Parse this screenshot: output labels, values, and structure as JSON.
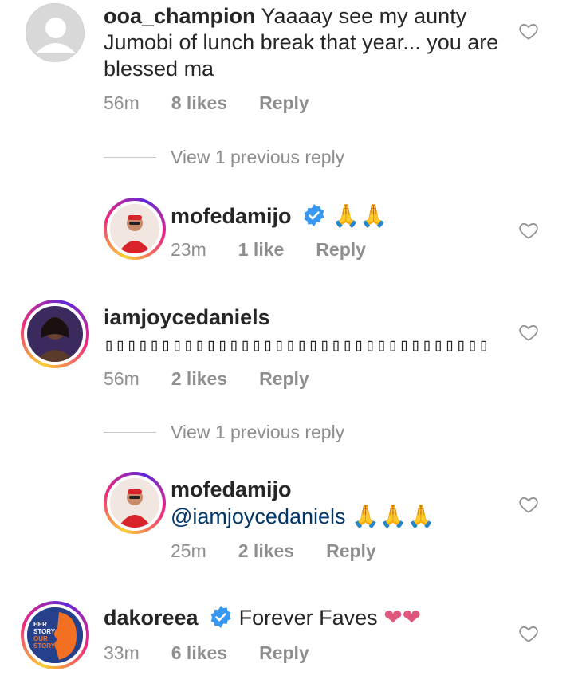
{
  "comments": [
    {
      "username": "ooa_champion",
      "text": "Yaaaay see my aunty Jumobi of lunch break that year... you are blessed ma",
      "time": "56m",
      "likes": "8 likes",
      "reply": "Reply"
    },
    {
      "view_previous": "View 1 previous reply",
      "username": "mofedamijo",
      "text": "🙏🙏",
      "time": "23m",
      "likes": "1 like",
      "reply": "Reply"
    },
    {
      "username": "iamjoycedaniels",
      "text": "▯▯▯▯▯▯▯▯▯▯▯▯▯▯▯▯▯▯▯▯▯▯▯▯▯▯▯▯▯▯▯▯▯▯",
      "time": "56m",
      "likes": "2 likes",
      "reply": "Reply"
    },
    {
      "view_previous": "View 1 previous reply",
      "username": "mofedamijo",
      "mention": "@iamjoycedaniels",
      "text": "🙏🙏🙏",
      "time": "25m",
      "likes": "2 likes",
      "reply": "Reply"
    },
    {
      "username": "dakoreea",
      "text": "Forever Faves",
      "hearts": "❤❤",
      "time": "33m",
      "likes": "6 likes",
      "reply": "Reply",
      "avatar_text": "HER STORY OUR STORY"
    }
  ],
  "colors": {
    "text": "#262626",
    "muted": "#8e8e8e",
    "mention": "#00376b",
    "verified": "#3897f0",
    "pink_heart": "#e1567c"
  }
}
